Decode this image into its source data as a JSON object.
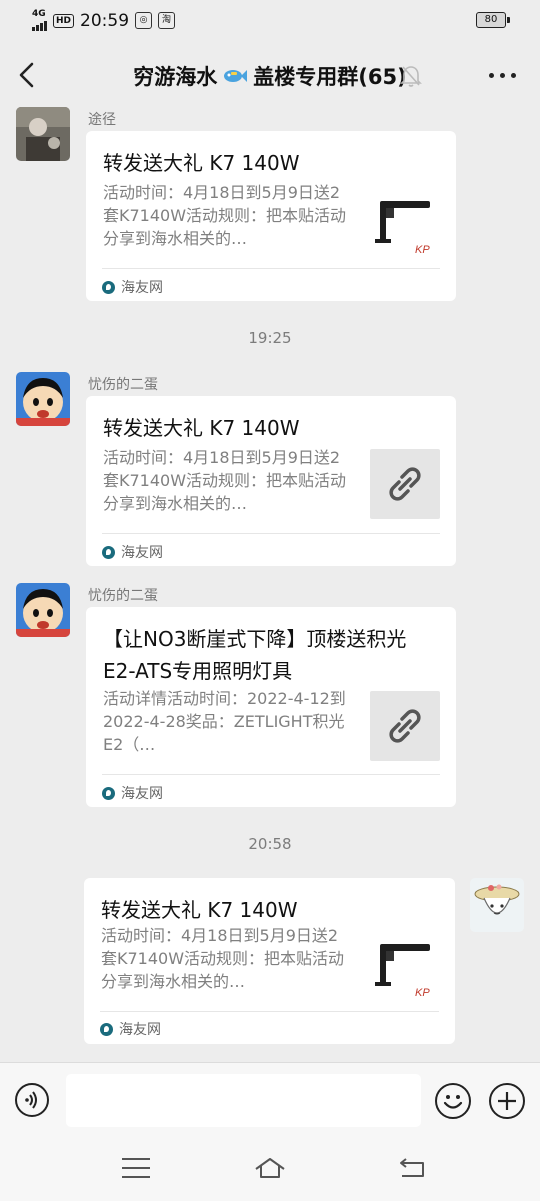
{
  "status_bar": {
    "network": "4G",
    "hd": "HD",
    "time": "20:59",
    "app_icon_2": "淘",
    "battery": "80"
  },
  "header": {
    "title_part1": "穷游海水",
    "title_part2": "盖楼专用群(65)"
  },
  "timestamps": [
    "19:25",
    "20:58"
  ],
  "messages": [
    {
      "sender": "途径",
      "title": "转发送大礼 K7 140W",
      "desc": "活动时间：4月18日到5月9日送2套K7140W活动规则：把本贴活动分享到海水相关的…",
      "source": "海友网",
      "thumb": "product-image",
      "thumb_brand": "KP"
    },
    {
      "sender": "忧伤的二蛋",
      "title": "转发送大礼 K7 140W",
      "desc": "活动时间：4月18日到5月9日送2套K7140W活动规则：把本贴活动分享到海水相关的…",
      "source": "海友网",
      "thumb": "link-icon"
    },
    {
      "sender": "忧伤的二蛋",
      "title": "【让NO3断崖式下降】顶楼送积光E2-ATS专用照明灯具",
      "desc": "活动详情活动时间：2022-4-12到2022-4-28奖品：ZETLIGHT积光E2（…",
      "source": "海友网",
      "thumb": "link-icon"
    },
    {
      "sender": "",
      "title": "转发送大礼 K7 140W",
      "desc": "活动时间：4月18日到5月9日送2套K7140W活动规则：把本贴活动分享到海水相关的…",
      "source": "海友网",
      "thumb": "product-image",
      "thumb_brand": "KP"
    }
  ],
  "input": {
    "value": ""
  },
  "icons": {
    "back": "back-arrow-icon",
    "mute": "mute-bell-icon",
    "more": "more-dots-icon",
    "fish": "fish-emoji-icon",
    "voice": "voice-icon",
    "emoji": "emoji-icon",
    "plus": "plus-icon",
    "link": "link-icon",
    "source": "haiyou-logo-icon"
  },
  "colors": {
    "background": "#ededed",
    "card": "#ffffff",
    "accent_source": "#1a6b7d"
  }
}
